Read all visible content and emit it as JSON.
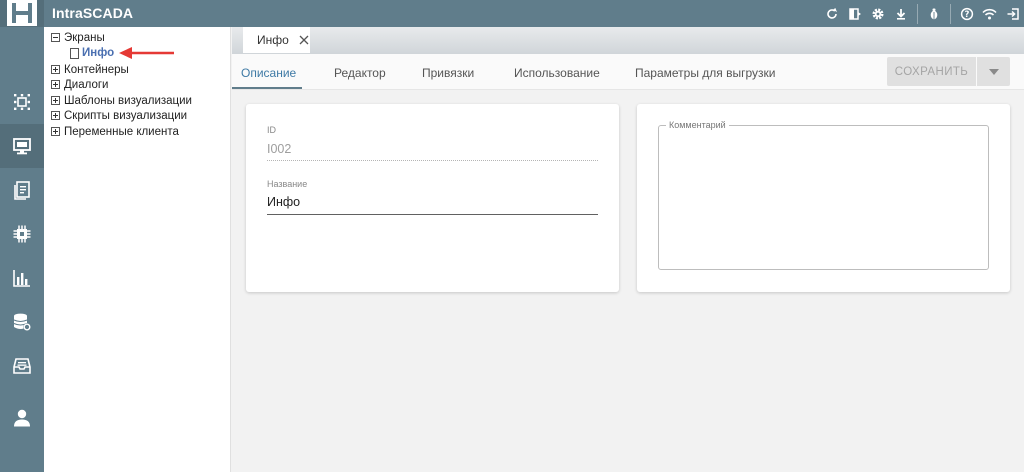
{
  "app": {
    "title": "IntraSCADA"
  },
  "topbar": {
    "icons": [
      "refresh-icon",
      "screen-share-icon",
      "gear-icon",
      "download-icon",
      "bug-icon",
      "help-icon",
      "wifi-icon",
      "logout-icon"
    ]
  },
  "rail": {
    "items": [
      "components-icon",
      "monitor-icon",
      "documents-icon",
      "chip-icon",
      "chart-icon",
      "database-settings-icon",
      "archive-icon",
      "user-icon"
    ],
    "active_index": 1
  },
  "tree": {
    "nodes": [
      {
        "label": "Экраны",
        "expanded": true,
        "children": [
          {
            "label": "Инфо"
          }
        ]
      },
      {
        "label": "Контейнеры",
        "expanded": false
      },
      {
        "label": "Диалоги",
        "expanded": false
      },
      {
        "label": "Шаблоны визуализации",
        "expanded": false
      },
      {
        "label": "Скрипты визуализации",
        "expanded": false
      },
      {
        "label": "Переменные клиента",
        "expanded": false
      }
    ]
  },
  "editor": {
    "tab_title": "Инфо",
    "subtabs": [
      "Описание",
      "Редактор",
      "Привязки",
      "Использование",
      "Параметры для выгрузки"
    ],
    "active_subtab": 0,
    "save_label": "СОХРАНИТЬ"
  },
  "form": {
    "id_label": "ID",
    "id_value": "I002",
    "name_label": "Название",
    "name_value": "Инфо",
    "comment_label": "Комментарий",
    "comment_value": ""
  },
  "colors": {
    "topbar": "#607d8b",
    "rail_active": "#546e7a",
    "accent": "#3f7aa5",
    "tree_child": "#4a6fb0",
    "arrow": "#e53935"
  }
}
